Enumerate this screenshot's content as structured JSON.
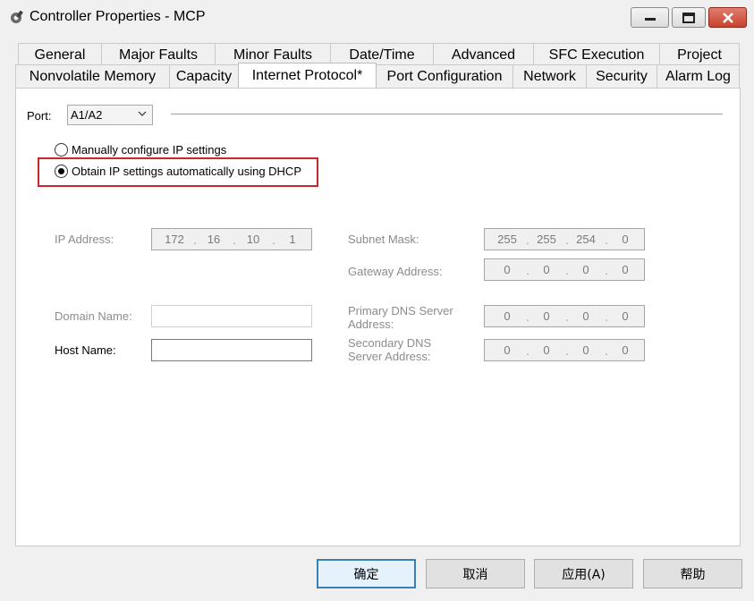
{
  "window": {
    "title": "Controller Properties - MCP",
    "controls": {
      "minimize": "minimize-icon",
      "maximize": "maximize-icon",
      "close": "close-icon"
    }
  },
  "tabs": {
    "row1": [
      "General",
      "Major Faults",
      "Minor Faults",
      "Date/Time",
      "Advanced",
      "SFC Execution",
      "Project"
    ],
    "row2": [
      "Nonvolatile Memory",
      "Capacity",
      "Internet Protocol*",
      "Port Configuration",
      "Network",
      "Security",
      "Alarm Log"
    ],
    "active": "Internet Protocol*"
  },
  "port": {
    "label": "Port:",
    "value": "A1/A2"
  },
  "ip_mode": {
    "manual_label": "Manually configure IP settings",
    "dhcp_label": "Obtain IP settings automatically using DHCP",
    "selected": "dhcp"
  },
  "fields": {
    "ip_address": {
      "label": "IP Address:",
      "octets": [
        "172",
        "16",
        "10",
        "1"
      ]
    },
    "subnet_mask": {
      "label": "Subnet Mask:",
      "octets": [
        "255",
        "255",
        "254",
        "0"
      ]
    },
    "gateway": {
      "label": "Gateway Address:",
      "octets": [
        "0",
        "0",
        "0",
        "0"
      ]
    },
    "domain_name": {
      "label": "Domain Name:",
      "value": ""
    },
    "host_name": {
      "label": "Host Name:",
      "value": ""
    },
    "primary_dns": {
      "label_line1": "Primary DNS Server",
      "label_line2": "Address:",
      "octets": [
        "0",
        "0",
        "0",
        "0"
      ]
    },
    "secondary_dns": {
      "label_line1": "Secondary DNS",
      "label_line2": "Server Address:",
      "octets": [
        "0",
        "0",
        "0",
        "0"
      ]
    }
  },
  "buttons": {
    "ok": "确定",
    "cancel": "取消",
    "apply": "应用(A)",
    "help": "帮助"
  },
  "colors": {
    "highlight": "#c8262d",
    "default_button_border": "#3c7fb1"
  }
}
